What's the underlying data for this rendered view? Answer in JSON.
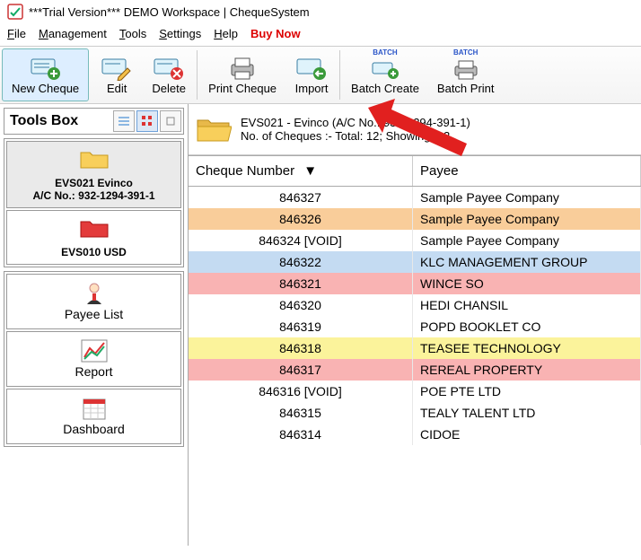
{
  "window": {
    "title": "***Trial Version*** DEMO Workspace | ChequeSystem"
  },
  "menu": {
    "file": "File",
    "management": "Management",
    "tools": "Tools",
    "settings": "Settings",
    "help": "Help",
    "buy_now": "Buy Now"
  },
  "toolbar": {
    "new_cheque": "New Cheque",
    "edit": "Edit",
    "delete": "Delete",
    "print_cheque": "Print Cheque",
    "import": "Import",
    "batch_create": "Batch Create",
    "batch_print": "Batch Print"
  },
  "toolsbox": {
    "title": "Tools Box",
    "accounts": [
      {
        "name": "EVS021 Evinco",
        "ac": "A/C No.: 932-1294-391-1",
        "color": "yellow"
      },
      {
        "name": "EVS010 USD",
        "ac": "",
        "color": "red"
      }
    ],
    "nav": {
      "payee_list": "Payee List",
      "report": "Report",
      "dashboard": "Dashboard"
    }
  },
  "info": {
    "line1": "EVS021 - Evinco (A/C No.: 932-1294-391-1)",
    "line2": "No. of Cheques :- Total: 12; Showing: 12"
  },
  "table": {
    "cols": {
      "cheque": "Cheque Number",
      "payee": "Payee"
    },
    "rows": [
      {
        "num": "846327",
        "payee": "Sample Payee Company",
        "cls": "clr-default"
      },
      {
        "num": "846326",
        "payee": "Sample Payee Company",
        "cls": "clr-orange"
      },
      {
        "num": "846324 [VOID]",
        "payee": "Sample Payee Company",
        "cls": "clr-default"
      },
      {
        "num": "846322",
        "payee": "KLC MANAGEMENT GROUP",
        "cls": "clr-blue"
      },
      {
        "num": "846321",
        "payee": "WINCE SO",
        "cls": "clr-pink"
      },
      {
        "num": "846320",
        "payee": "HEDI CHANSIL",
        "cls": "clr-default"
      },
      {
        "num": "846319",
        "payee": "POPD BOOKLET CO",
        "cls": "clr-default"
      },
      {
        "num": "846318",
        "payee": "TEASEE TECHNOLOGY",
        "cls": "clr-yellow"
      },
      {
        "num": "846317",
        "payee": "REREAL PROPERTY",
        "cls": "clr-pink"
      },
      {
        "num": "846316 [VOID]",
        "payee": "POE PTE LTD",
        "cls": "clr-default"
      },
      {
        "num": "846315",
        "payee": "TEALY TALENT LTD",
        "cls": "clr-default"
      },
      {
        "num": "846314",
        "payee": "CIDOE",
        "cls": "clr-default"
      }
    ]
  }
}
